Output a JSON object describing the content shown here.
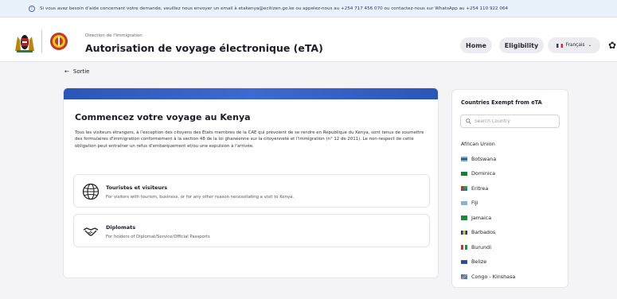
{
  "notice": {
    "text": "Si vous avez besoin d'aide concernant votre demande, veuillez nous envoyer un email à etakenya@ecitizen.go.ke ou appelez-nous au +254 717 456 070 ou contactez-nous sur WhatsApp au +254 110 922 064"
  },
  "header": {
    "department": "Direction de l'Immigration",
    "title": "Autorisation de voyage électronique (eTA)",
    "home_label": "Home",
    "eligibility_label": "Eligibility",
    "language_label": "Français"
  },
  "back_label": "Sortie",
  "main": {
    "title": "Commencez votre voyage au Kenya",
    "description": "Tous les visiteurs étrangers, à l'exception des citoyens des États membres de la CAE qui prévoient de se rendre en République du Kenya, sont tenus de soumettre des formulaires d'immigration conformément à la section 48 de la loi ghanéenne sur la citoyenneté et l'immigration (n° 12 de 2011). Le non-respect de cette obligation peut entraîner un refus d'embarquement et/ou une expulsion à l'arrivée.",
    "options": [
      {
        "title": "Touristes et visiteurs",
        "description": "For visitors with tourism, business, or for any other reason necessitating a visit to Kenya."
      },
      {
        "title": "Diplomats",
        "description": "For holders of Diplomat/Service/Official Passports"
      }
    ]
  },
  "sidebar": {
    "title": "Countries Exempt from eTA",
    "search_placeholder": "Search Country",
    "countries": [
      {
        "name": "African Union",
        "flag": "none"
      },
      {
        "name": "Botswana",
        "flag": "botswana"
      },
      {
        "name": "Dominica",
        "flag": "dominica"
      },
      {
        "name": "Eritrea",
        "flag": "eritrea"
      },
      {
        "name": "Fiji",
        "flag": "fiji"
      },
      {
        "name": "Jamaica",
        "flag": "jamaica"
      },
      {
        "name": "Barbados",
        "flag": "barbados"
      },
      {
        "name": "Burundi",
        "flag": "burundi"
      },
      {
        "name": "Belize",
        "flag": "belize"
      },
      {
        "name": "Congo - Kinshasa",
        "flag": "congo-kinshasa"
      }
    ]
  },
  "colors": {
    "accent": "#2c55b8",
    "notice_bg": "#e9f1fb",
    "pill_bg": "#ececf0"
  }
}
